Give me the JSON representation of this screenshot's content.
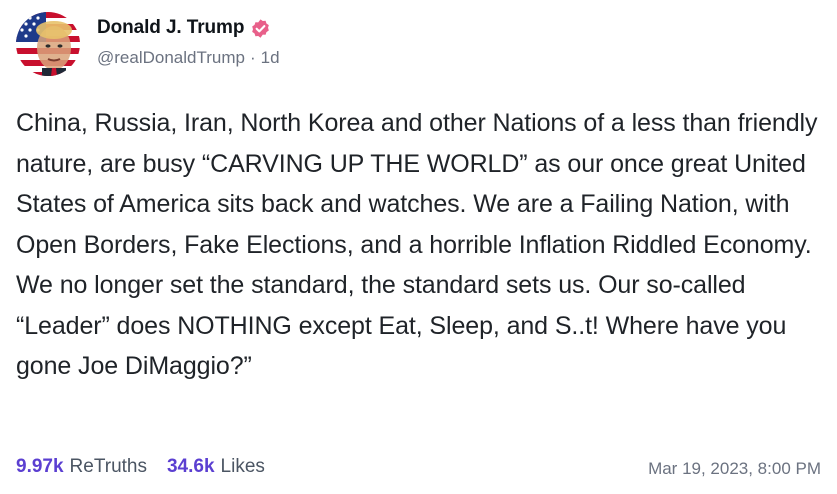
{
  "author": {
    "display_name": "Donald J. Trump",
    "handle": "@realDonaldTrump",
    "separator": "·",
    "relative_time": "1d",
    "verified_icon": "verified-badge-icon",
    "verified_color": "#e8608a"
  },
  "post": {
    "text": "China, Russia, Iran, North Korea and other Nations of a less than friendly nature, are busy “CARVING UP THE WORLD” as our once great United States of America sits back and watches. We are a Failing Nation, with Open Borders, Fake Elections, and a horrible Inflation Riddled Economy. We no longer set the standard, the standard sets us. Our so-called “Leader” does NOTHING except Eat, Sleep, and S..t! Where have you gone Joe DiMaggio?”"
  },
  "stats": {
    "retruths_count": "9.97k",
    "retruths_label": "ReTruths",
    "likes_count": "34.6k",
    "likes_label": "Likes"
  },
  "timestamp": "Mar 19, 2023, 8:00 PM",
  "colors": {
    "accent": "#5b3fd1",
    "muted": "#6b7280"
  }
}
